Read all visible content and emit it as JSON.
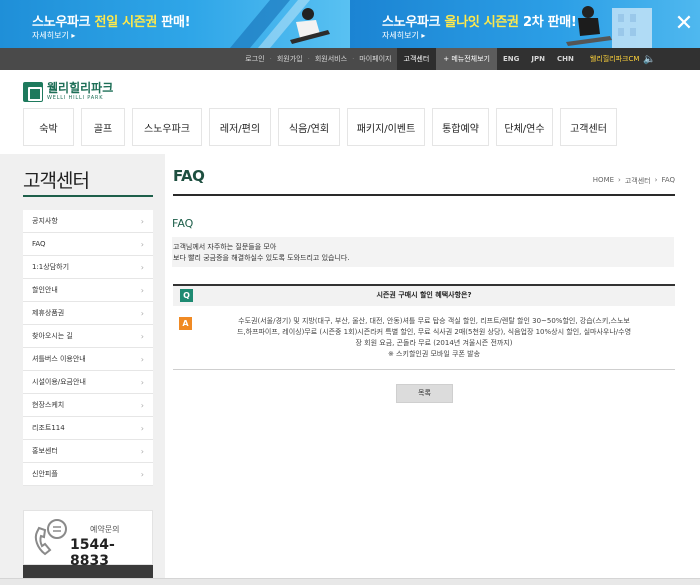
{
  "banners": {
    "left": {
      "title_pre": "스노우파크 ",
      "title_hl": "전일 시즌권",
      "title_post": " 판매!",
      "more": "자세히보기 ▸"
    },
    "right": {
      "title_pre": "스노우파크 ",
      "title_hl": "올나잇 시즌권",
      "title_post": " 2차 판매!",
      "more": "자세히보기 ▸"
    },
    "close": "✕"
  },
  "util_bar": {
    "links": [
      "로그인",
      "회원가입",
      "회원서비스",
      "마이페이지"
    ],
    "active": "고객센터",
    "menu_all": "+ 메뉴전체보기",
    "languages": [
      "ENG",
      "JPN",
      "CHN"
    ],
    "cm": "웰리힐리파크CM",
    "speaker_icon": "speaker-icon"
  },
  "logo": {
    "ko": "웰리힐리파크",
    "en": "WELLI HILLI PARK"
  },
  "gnb": [
    "숙박",
    "골프",
    "스노우파크",
    "레저/편의",
    "식음/연회",
    "패키지/이벤트",
    "통합예약",
    "단체/연수",
    "고객센터"
  ],
  "lnb": {
    "title": "고객센터",
    "items": [
      "공지사항",
      "FAQ",
      "1:1상담하기",
      "할인안내",
      "제휴상품권",
      "찾아오시는 길",
      "셔틀버스 이용안내",
      "시설이용/요금안내",
      "현장스케치",
      "리조트114",
      "홍보센터",
      "신안피플"
    ]
  },
  "call": {
    "label": "예약문의",
    "number": "1544-8833"
  },
  "content": {
    "title": "FAQ",
    "breadcrumb": [
      "HOME",
      "›",
      "고객센터",
      "›",
      "FAQ"
    ],
    "faq_sub": "FAQ",
    "faq_desc1": "고객님께서 자주하는 질문들을 모아",
    "faq_desc2": "보다 빨리 궁금증을 해결하실수 있도록 도와드리고 있습니다.",
    "q_badge": "Q",
    "question": "시즌권 구매시 할인 혜택사항은?",
    "a_badge": "A",
    "answer_l1": "수도권(서울/경기) 및 지방(대구, 부산, 울산, 대전, 안동)셔틀 무료 탑승 객실 할인, 리프트/렌탈 할인 30~50%할인, 강습(스키,스노보",
    "answer_l2": "드,하프파이프, 레이싱)무료 (시즌중 1회)시즌라커 특별 할인, 무료 식사권 2매(5천원 상당), 식음업장 10%상시 할인, 실마사우나/수영",
    "answer_l3": "장 회원 요금, 곤돌라 무료 (2014년 겨울시즌 전까지)",
    "answer_l4": "※ 스키할인권 모바일 쿠폰 발송",
    "list_button": "목록"
  }
}
